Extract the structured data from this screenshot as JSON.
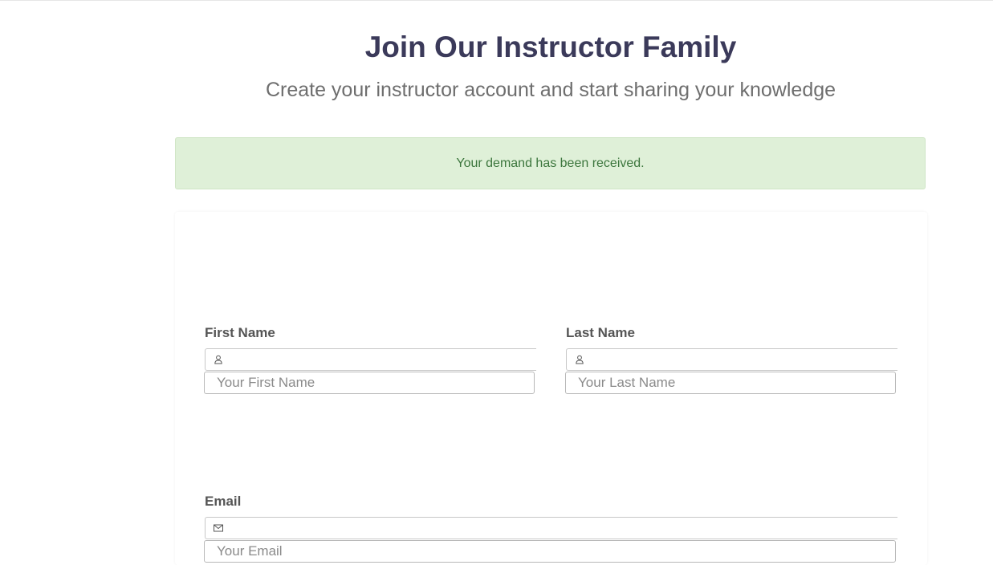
{
  "header": {
    "title": "Join Our Instructor Family",
    "subtitle": "Create your instructor account and start sharing your knowledge"
  },
  "alert": {
    "message": "Your demand has been received.",
    "color": "#3c763d",
    "background": "#dff0d8"
  },
  "form": {
    "first_name": {
      "label": "First Name",
      "placeholder": "Your First Name",
      "value": "",
      "icon": "user-icon"
    },
    "last_name": {
      "label": "Last Name",
      "placeholder": "Your Last Name",
      "value": "",
      "icon": "user-icon"
    },
    "email": {
      "label": "Email",
      "placeholder": "Your Email",
      "value": "",
      "icon": "envelope-icon"
    }
  },
  "colors": {
    "title": "#3b3a5a",
    "subtitle": "#6e6e6e",
    "label": "#555555"
  }
}
